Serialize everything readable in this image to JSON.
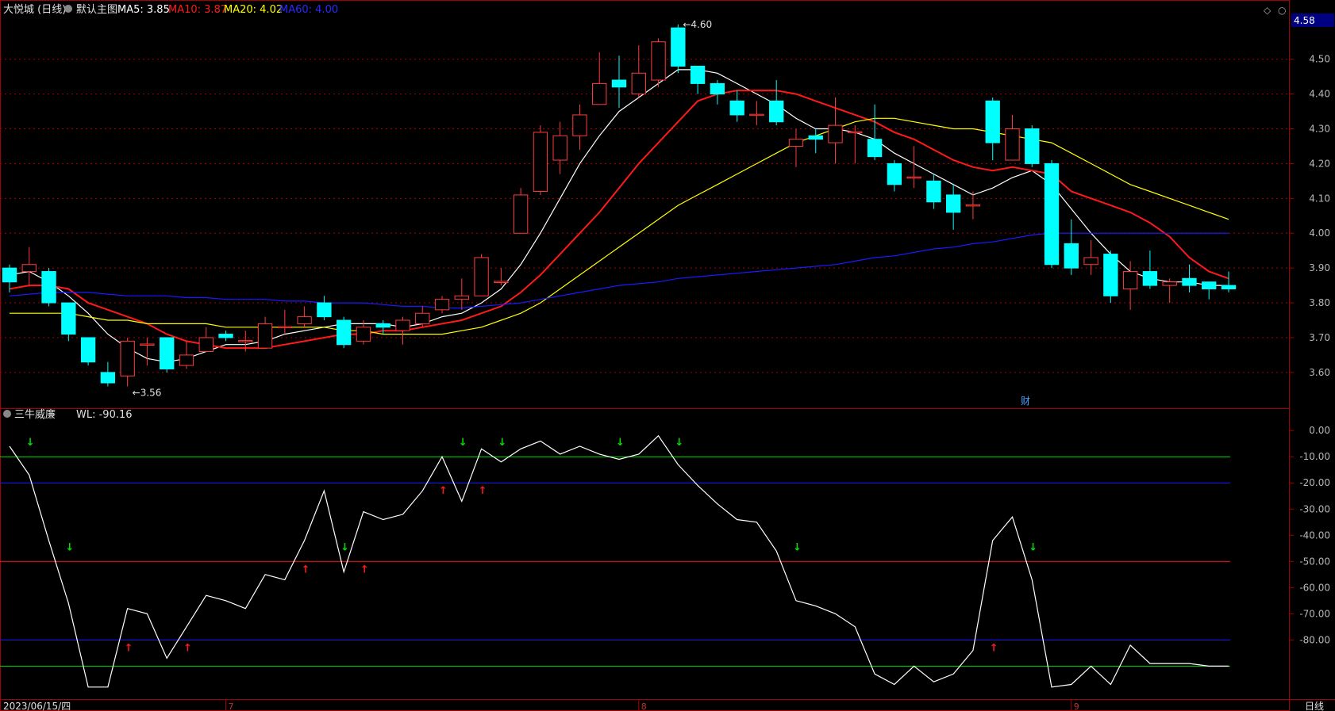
{
  "colors": {
    "bg": "#000000",
    "frame": "#a80000",
    "up": "#ff3b3b",
    "down": "#00ffff",
    "ma5": "#ffffff",
    "ma10": "#ff1a1a",
    "ma20": "#ffff00",
    "ma60": "#1a1aff",
    "axis_text": "#b8b8b8",
    "wl_line": "#ffffff",
    "green": "#00e000",
    "red": "#ff1a1a",
    "blue": "#1a1aff"
  },
  "header": {
    "stock": "大悦城 (日线)",
    "main_label": "默认主图",
    "ma5": "MA5: 3.85",
    "ma10": "MA10: 3.87",
    "ma20": "MA20: 4.02",
    "ma60": "MA60: 4.00"
  },
  "sub_header": {
    "name": "三牛威廉",
    "value": "WL: -90.16"
  },
  "bottom": {
    "date": "2023/06/15/四",
    "period": "日线"
  },
  "month_labels": [
    "7",
    "8",
    "9"
  ],
  "cai_marker": "财",
  "chart_data": [
    {
      "type": "candlestick",
      "price_ylim": [
        3.52,
        4.62
      ],
      "yticks": [
        3.6,
        3.7,
        3.8,
        3.9,
        4.0,
        4.1,
        4.2,
        4.3,
        4.4,
        4.5
      ],
      "last_price": "4.58",
      "annotations": [
        {
          "text": "4.60",
          "index": 34
        },
        {
          "text": "3.56",
          "index": 6
        }
      ],
      "candles": [
        [
          3.9,
          3.86,
          3.91,
          3.83
        ],
        [
          3.89,
          3.91,
          3.96,
          3.85
        ],
        [
          3.89,
          3.8,
          3.9,
          3.79
        ],
        [
          3.8,
          3.71,
          3.8,
          3.69
        ],
        [
          3.7,
          3.63,
          3.7,
          3.62
        ],
        [
          3.6,
          3.57,
          3.63,
          3.56
        ],
        [
          3.59,
          3.69,
          3.7,
          3.56
        ],
        [
          3.68,
          3.68,
          3.7,
          3.62
        ],
        [
          3.7,
          3.61,
          3.7,
          3.6
        ],
        [
          3.62,
          3.65,
          3.69,
          3.61
        ],
        [
          3.66,
          3.7,
          3.73,
          3.66
        ],
        [
          3.71,
          3.7,
          3.72,
          3.69
        ],
        [
          3.69,
          3.69,
          3.72,
          3.66
        ],
        [
          3.67,
          3.74,
          3.76,
          3.67
        ],
        [
          3.73,
          3.73,
          3.78,
          3.71
        ],
        [
          3.74,
          3.76,
          3.79,
          3.73
        ],
        [
          3.8,
          3.76,
          3.82,
          3.75
        ],
        [
          3.75,
          3.68,
          3.76,
          3.67
        ],
        [
          3.69,
          3.73,
          3.75,
          3.68
        ],
        [
          3.74,
          3.73,
          3.75,
          3.71
        ],
        [
          3.72,
          3.75,
          3.76,
          3.68
        ],
        [
          3.74,
          3.77,
          3.79,
          3.73
        ],
        [
          3.78,
          3.81,
          3.82,
          3.77
        ],
        [
          3.81,
          3.82,
          3.87,
          3.78
        ],
        [
          3.82,
          3.93,
          3.94,
          3.82
        ],
        [
          3.86,
          3.86,
          3.9,
          3.85
        ],
        [
          4.0,
          4.11,
          4.13,
          4.0
        ],
        [
          4.12,
          4.29,
          4.31,
          4.11
        ],
        [
          4.21,
          4.28,
          4.32,
          4.17
        ],
        [
          4.28,
          4.34,
          4.37,
          4.24
        ],
        [
          4.37,
          4.43,
          4.52,
          4.37
        ],
        [
          4.44,
          4.42,
          4.51,
          4.36
        ],
        [
          4.4,
          4.46,
          4.54,
          4.39
        ],
        [
          4.44,
          4.55,
          4.56,
          4.42
        ],
        [
          4.59,
          4.48,
          4.6,
          4.46
        ],
        [
          4.48,
          4.43,
          4.48,
          4.4
        ],
        [
          4.43,
          4.4,
          4.44,
          4.37
        ],
        [
          4.38,
          4.34,
          4.41,
          4.32
        ],
        [
          4.34,
          4.34,
          4.38,
          4.31
        ],
        [
          4.38,
          4.32,
          4.44,
          4.31
        ],
        [
          4.25,
          4.27,
          4.3,
          4.19
        ],
        [
          4.28,
          4.27,
          4.3,
          4.23
        ],
        [
          4.26,
          4.31,
          4.39,
          4.2
        ],
        [
          4.29,
          4.29,
          4.31,
          4.2
        ],
        [
          4.27,
          4.22,
          4.37,
          4.21
        ],
        [
          4.2,
          4.14,
          4.21,
          4.12
        ],
        [
          4.16,
          4.16,
          4.25,
          4.13
        ],
        [
          4.15,
          4.09,
          4.17,
          4.07
        ],
        [
          4.11,
          4.06,
          4.14,
          4.01
        ],
        [
          4.08,
          4.08,
          4.12,
          4.04
        ],
        [
          4.38,
          4.26,
          4.39,
          4.21
        ],
        [
          4.21,
          4.3,
          4.34,
          4.23
        ],
        [
          4.3,
          4.2,
          4.31,
          4.19
        ],
        [
          4.2,
          3.91,
          4.21,
          3.9
        ],
        [
          3.97,
          3.9,
          4.04,
          3.88
        ],
        [
          3.91,
          3.93,
          3.98,
          3.88
        ],
        [
          3.94,
          3.82,
          3.95,
          3.8
        ],
        [
          3.84,
          3.89,
          3.92,
          3.78
        ],
        [
          3.89,
          3.85,
          3.95,
          3.84
        ],
        [
          3.85,
          3.86,
          3.87,
          3.8
        ],
        [
          3.87,
          3.85,
          3.91,
          3.83
        ],
        [
          3.86,
          3.84,
          3.86,
          3.81
        ],
        [
          3.85,
          3.84,
          3.89,
          3.83
        ]
      ],
      "series": [
        {
          "name": "MA5",
          "color": "ma5",
          "start": 0,
          "values": [
            3.88,
            3.89,
            3.86,
            3.82,
            3.77,
            3.71,
            3.67,
            3.64,
            3.63,
            3.64,
            3.66,
            3.68,
            3.68,
            3.69,
            3.71,
            3.72,
            3.73,
            3.74,
            3.74,
            3.74,
            3.73,
            3.74,
            3.76,
            3.77,
            3.8,
            3.84,
            3.91,
            4.0,
            4.1,
            4.2,
            4.28,
            4.35,
            4.39,
            4.43,
            4.47,
            4.47,
            4.46,
            4.43,
            4.4,
            4.37,
            4.33,
            4.3,
            4.3,
            4.29,
            4.27,
            4.23,
            4.2,
            4.17,
            4.14,
            4.11,
            4.13,
            4.16,
            4.18,
            4.14,
            4.07,
            4.0,
            3.94,
            3.89,
            3.87,
            3.86,
            3.86,
            3.85,
            3.85
          ]
        },
        {
          "name": "MA10",
          "color": "ma10",
          "start": 0,
          "values": [
            3.84,
            3.85,
            3.85,
            3.84,
            3.8,
            3.78,
            3.76,
            3.74,
            3.71,
            3.69,
            3.68,
            3.67,
            3.67,
            3.67,
            3.68,
            3.69,
            3.7,
            3.71,
            3.71,
            3.72,
            3.72,
            3.73,
            3.74,
            3.75,
            3.77,
            3.79,
            3.83,
            3.88,
            3.94,
            4.0,
            4.06,
            4.13,
            4.2,
            4.26,
            4.32,
            4.38,
            4.4,
            4.41,
            4.41,
            4.41,
            4.4,
            4.38,
            4.36,
            4.34,
            4.32,
            4.29,
            4.27,
            4.24,
            4.21,
            4.19,
            4.18,
            4.19,
            4.18,
            4.17,
            4.12,
            4.1,
            4.08,
            4.06,
            4.03,
            3.99,
            3.93,
            3.89,
            3.87
          ]
        },
        {
          "name": "MA20",
          "color": "ma20",
          "start": 0,
          "values": [
            3.77,
            3.77,
            3.77,
            3.77,
            3.76,
            3.75,
            3.75,
            3.74,
            3.74,
            3.74,
            3.74,
            3.73,
            3.73,
            3.73,
            3.73,
            3.73,
            3.73,
            3.72,
            3.72,
            3.71,
            3.71,
            3.71,
            3.71,
            3.72,
            3.73,
            3.75,
            3.77,
            3.8,
            3.84,
            3.88,
            3.92,
            3.96,
            4.0,
            4.04,
            4.08,
            4.11,
            4.14,
            4.17,
            4.2,
            4.23,
            4.26,
            4.28,
            4.3,
            4.32,
            4.33,
            4.33,
            4.32,
            4.31,
            4.3,
            4.3,
            4.29,
            4.28,
            4.27,
            4.26,
            4.23,
            4.2,
            4.17,
            4.14,
            4.12,
            4.1,
            4.08,
            4.06,
            4.04,
            4.02
          ]
        },
        {
          "name": "MA60",
          "color": "ma60",
          "start": 0,
          "values": [
            3.82,
            3.825,
            3.83,
            3.83,
            3.83,
            3.825,
            3.82,
            3.82,
            3.82,
            3.815,
            3.815,
            3.81,
            3.81,
            3.81,
            3.805,
            3.805,
            3.8,
            3.8,
            3.8,
            3.795,
            3.79,
            3.79,
            3.785,
            3.785,
            3.79,
            3.795,
            3.8,
            3.81,
            3.82,
            3.83,
            3.84,
            3.85,
            3.855,
            3.86,
            3.87,
            3.875,
            3.88,
            3.885,
            3.89,
            3.895,
            3.9,
            3.905,
            3.91,
            3.92,
            3.93,
            3.935,
            3.945,
            3.955,
            3.96,
            3.97,
            3.975,
            3.985,
            3.995,
            4.0,
            4.0,
            4.0,
            4.0,
            4.0,
            4.0,
            4.0,
            4.0,
            4.0,
            4.0
          ]
        }
      ]
    },
    {
      "type": "line",
      "name": "三牛威廉",
      "ylim": [
        -102,
        4
      ],
      "yticks": [
        0,
        -10,
        -20,
        -30,
        -40,
        -50,
        -60,
        -70,
        -80
      ],
      "hlines": [
        {
          "value": -10,
          "color": "green"
        },
        {
          "value": -20,
          "color": "blue"
        },
        {
          "value": -50,
          "color": "red"
        },
        {
          "value": -80,
          "color": "blue"
        },
        {
          "value": -90,
          "color": "green"
        }
      ],
      "values": [
        -6,
        -17,
        -42,
        -66,
        -98,
        -98,
        -68,
        -70,
        -87,
        -75,
        -63,
        -65,
        -68,
        -55,
        -57,
        -42,
        -23,
        -54,
        -31,
        -34,
        -32,
        -23,
        -10,
        -27,
        -7,
        -12,
        -7,
        -4,
        -9,
        -6,
        -9,
        -11,
        -9,
        -2,
        -13,
        -21,
        -28,
        -34,
        -35,
        -46,
        -65,
        -67,
        -70,
        -75,
        -93,
        -97,
        -90,
        -96,
        -93,
        -84,
        -42,
        -33,
        -57,
        -98,
        -97,
        -90,
        -97,
        -82,
        -89,
        -89,
        -89,
        -90,
        -90
      ],
      "up_arrows": [
        6,
        9,
        15,
        18,
        22,
        24,
        50
      ],
      "down_arrows": [
        1,
        3,
        17,
        23,
        25,
        31,
        34,
        40,
        52
      ],
      "up_arrows_low": [
        6,
        9,
        50
      ]
    }
  ]
}
